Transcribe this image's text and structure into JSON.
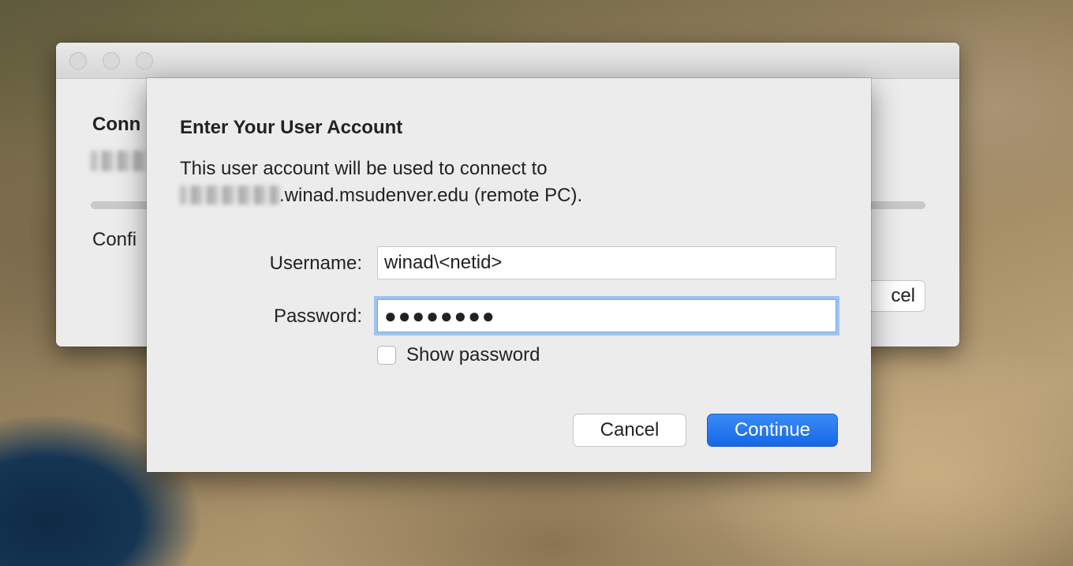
{
  "background_window": {
    "title_partial": "Conn",
    "status_partial": "Confi",
    "cancel_partial": "cel"
  },
  "dialog": {
    "title": "Enter Your User Account",
    "message_line1": "This user account will be used to connect to",
    "message_line2_suffix": ".winad.msudenver.edu (remote PC).",
    "username_label": "Username:",
    "username_value": "winad\\<netid>",
    "password_label": "Password:",
    "password_value": "●●●●●●●●",
    "show_password_label": "Show password",
    "cancel_label": "Cancel",
    "continue_label": "Continue"
  },
  "colors": {
    "accent": "#1a6ff0",
    "focus_ring": "#9fc3f0"
  }
}
